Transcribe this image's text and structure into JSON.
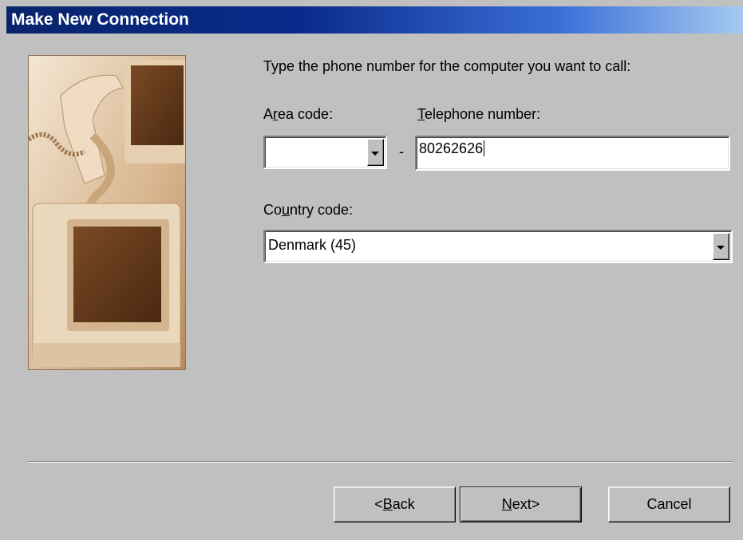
{
  "window": {
    "title": "Make New Connection"
  },
  "prompt": "Type the phone number for the computer you want to call:",
  "area_code": {
    "label_pre": "A",
    "label_accel": "r",
    "label_post": "ea code:",
    "value": ""
  },
  "dash": "-",
  "telephone": {
    "label_accel": "T",
    "label_post": "elephone number:",
    "value": "80262626"
  },
  "country_code": {
    "label_pre": "Co",
    "label_accel": "u",
    "label_post": "ntry code:",
    "value": "Denmark (45)"
  },
  "buttons": {
    "back": {
      "arrow": "<",
      "accel": "B",
      "rest": "ack"
    },
    "next": {
      "accel": "N",
      "rest": "ext",
      "arrow": ">"
    },
    "cancel": {
      "label": "Cancel"
    }
  },
  "illustration": {
    "name": "computer-phone-illustration",
    "tone": "sepia"
  }
}
